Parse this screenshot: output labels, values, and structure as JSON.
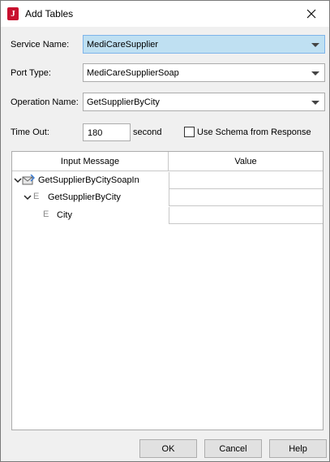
{
  "window": {
    "title": "Add Tables"
  },
  "form": {
    "service_name": {
      "label": "Service Name:",
      "value": "MediCareSupplier"
    },
    "port_type": {
      "label": "Port Type:",
      "value": "MediCareSupplierSoap"
    },
    "operation_name": {
      "label": "Operation Name:",
      "value": "GetSupplierByCity"
    },
    "timeout": {
      "label": "Time Out:",
      "value": "180",
      "unit": "second"
    },
    "use_schema": {
      "label": "Use Schema from Response",
      "checked": false
    }
  },
  "table": {
    "headers": [
      "Input Message",
      "Value"
    ],
    "rows": [
      {
        "label": "GetSupplierByCitySoapIn",
        "icon": "message-icon",
        "expanded": true
      },
      {
        "label": "GetSupplierByCity",
        "icon": "element-icon",
        "type_glyph": "E",
        "expanded": true
      },
      {
        "label": "City",
        "icon": "element-icon",
        "type_glyph": "E"
      }
    ]
  },
  "buttons": {
    "ok": "OK",
    "cancel": "Cancel",
    "help": "Help"
  },
  "colors": {
    "selection": "#bfe0f2",
    "app_icon": "#c8102e"
  }
}
